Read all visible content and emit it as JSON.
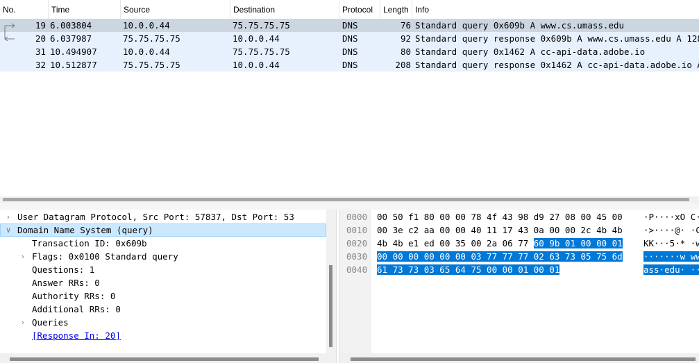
{
  "packet_list": {
    "columns": [
      "No.",
      "Time",
      "Source",
      "Destination",
      "Protocol",
      "Length",
      "Info"
    ],
    "rows": [
      {
        "no": "19",
        "time": "6.003804",
        "source": "10.0.0.44",
        "destination": "75.75.75.75",
        "protocol": "DNS",
        "length": "76",
        "info": "Standard query 0x609b A www.cs.umass.edu"
      },
      {
        "no": "20",
        "time": "6.037987",
        "source": "75.75.75.75",
        "destination": "10.0.0.44",
        "protocol": "DNS",
        "length": "92",
        "info": "Standard query response 0x609b A www.cs.umass.edu A 128"
      },
      {
        "no": "31",
        "time": "10.494907",
        "source": "10.0.0.44",
        "destination": "75.75.75.75",
        "protocol": "DNS",
        "length": "80",
        "info": "Standard query 0x1462 A cc-api-data.adobe.io"
      },
      {
        "no": "32",
        "time": "10.512877",
        "source": "75.75.75.75",
        "destination": "10.0.0.44",
        "protocol": "DNS",
        "length": "208",
        "info": "Standard query response 0x1462 A cc-api-data.adobe.io A"
      }
    ]
  },
  "details": {
    "udp": "User Datagram Protocol, Src Port: 57837, Dst Port: 53",
    "dns": "Domain Name System (query)",
    "transaction_id": "Transaction ID: 0x609b",
    "flags": "Flags: 0x0100 Standard query",
    "questions": "Questions: 1",
    "answer_rrs": "Answer RRs: 0",
    "authority_rrs": "Authority RRs: 0",
    "additional_rrs": "Additional RRs: 0",
    "queries": "Queries",
    "response_in": "[Response In: 20]"
  },
  "bytes": {
    "lines": [
      {
        "offset": "0000",
        "hex_plain": "00 50 f1 80 00 00 78 4f  43 98 d9 27 08 00 45 00",
        "hex_hl": "",
        "ascii_plain": "·P····xO C·",
        "ascii_hl": ""
      },
      {
        "offset": "0010",
        "hex_plain": "00 3e c2 aa 00 00 40 11  17 43 0a 00 00 2c 4b 4b",
        "hex_hl": "",
        "ascii_plain": "·>····@· ·C",
        "ascii_hl": ""
      },
      {
        "offset": "0020",
        "hex_plain": "4b 4b e1 ed 00 35 00 2a  06 77 ",
        "hex_hl": "60 9b 01 00 00 01",
        "ascii_plain": "KK···5·* ·w",
        "ascii_hl": ""
      },
      {
        "offset": "0030",
        "hex_plain": "",
        "hex_hl": "00 00 00 00 00 00 03 77  77 77 02 63 73 05 75 6d",
        "ascii_plain": "",
        "ascii_hl": "·······w ww"
      },
      {
        "offset": "0040",
        "hex_plain": "",
        "hex_hl": "61 73 73 03 65 64 75 00  00 01 00 01",
        "ascii_plain": "",
        "ascii_hl": "ass·edu· ··"
      }
    ]
  }
}
